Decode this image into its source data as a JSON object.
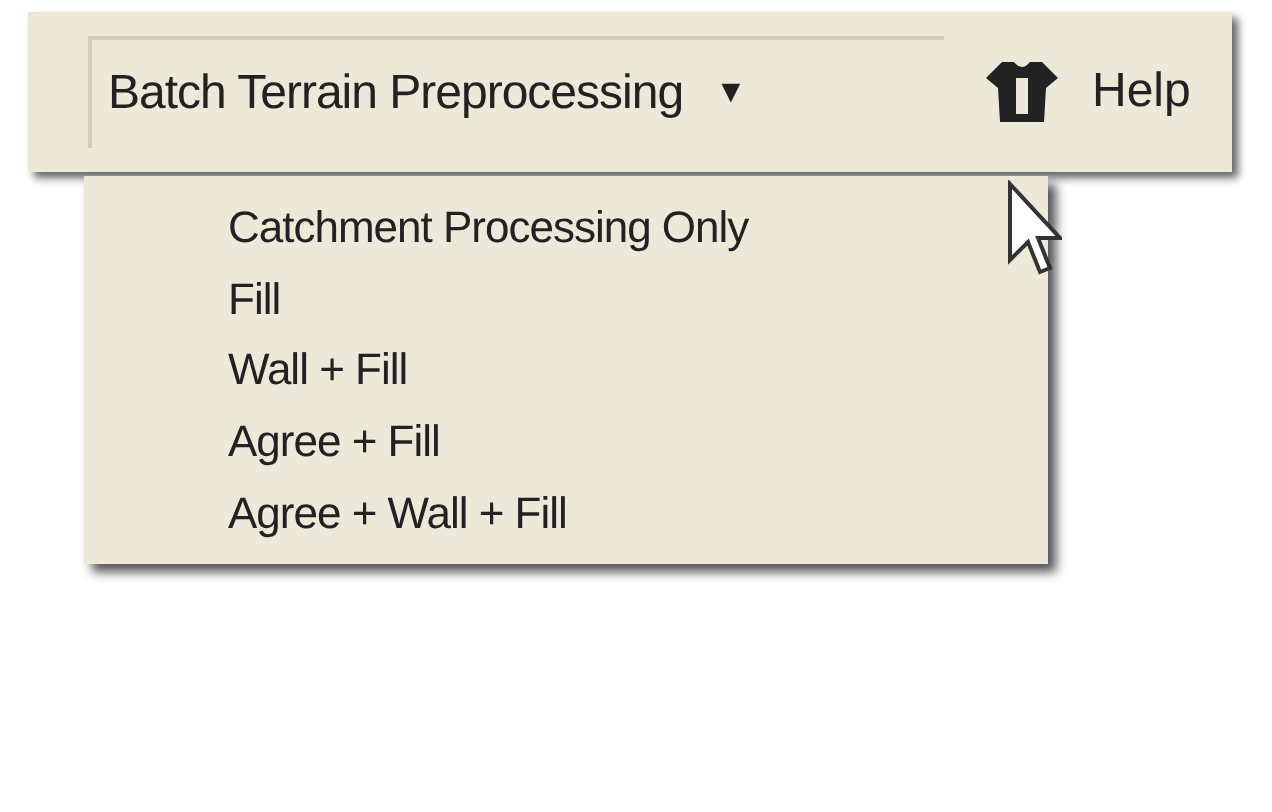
{
  "toolbar": {
    "dropdown": {
      "label": "Batch Terrain Preprocessing",
      "caret": "▼",
      "expanded": true
    },
    "help": {
      "label": "Help"
    }
  },
  "menu": {
    "items": [
      {
        "label": "Catchment Processing Only"
      },
      {
        "label": "Fill"
      },
      {
        "label": "Wall + Fill"
      },
      {
        "label": "Agree + Fill"
      },
      {
        "label": "Agree + Wall + Fill"
      }
    ]
  }
}
